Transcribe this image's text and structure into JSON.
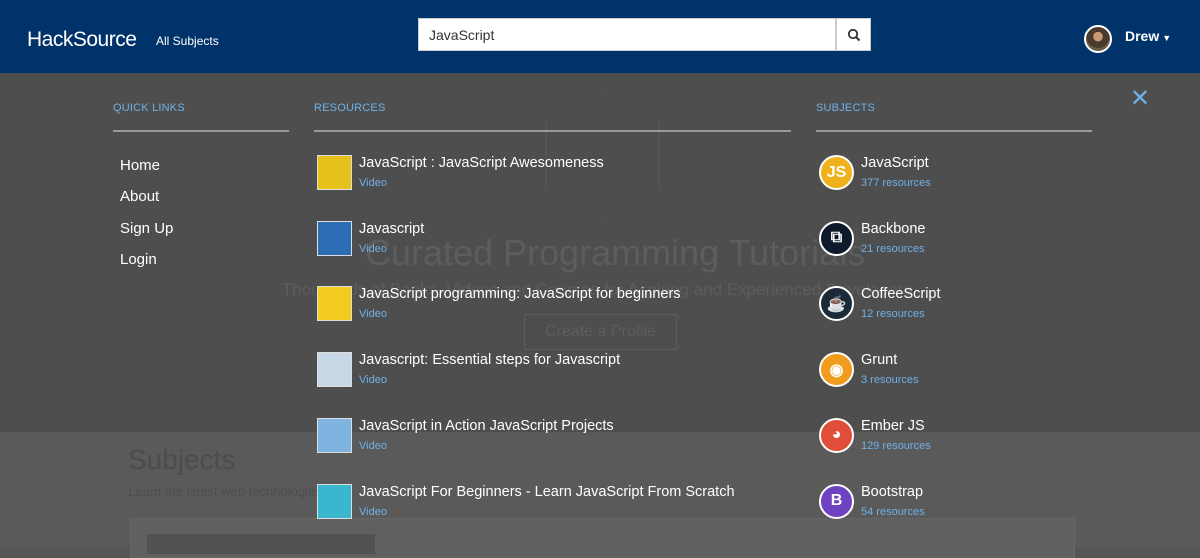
{
  "nav": {
    "logo": "HackSource",
    "all_subjects": "All Subjects",
    "search_value": "JavaScript",
    "user": "Drew"
  },
  "background": {
    "hero_title": "Curated Programming Tutorials",
    "hero_subtitle": "Thousands of Books, Videos and Courses for Aspiring and Experienced Developers",
    "cta": "Create a Profile",
    "section_title": "Subjects",
    "section_subtitle": "Learn the latest web technologies"
  },
  "overlay": {
    "quick_links_header": "QUICK LINKS",
    "resources_header": "RESOURCES",
    "subjects_header": "SUBJECTS",
    "quick_links": [
      "Home",
      "About",
      "Sign Up",
      "Login"
    ],
    "resources": [
      {
        "title": "JavaScript : JavaScript Awesomeness",
        "type": "Video",
        "color": "#e8c21c"
      },
      {
        "title": "Javascript",
        "type": "Video",
        "color": "#2d6db5"
      },
      {
        "title": "JavaScript programming: JavaScript for beginners",
        "type": "Video",
        "color": "#f2cc1e"
      },
      {
        "title": "Javascript: Essential steps for Javascript",
        "type": "Video",
        "color": "#c9d8e6"
      },
      {
        "title": "JavaScript in Action JavaScript Projects",
        "type": "Video",
        "color": "#7fb4e0"
      },
      {
        "title": "JavaScript For Beginners - Learn JavaScript From Scratch",
        "type": "Video",
        "color": "#3ab7cf"
      }
    ],
    "subjects": [
      {
        "name": "JavaScript",
        "count": "377 resources",
        "glyph": "JS",
        "color": "#f0b21a"
      },
      {
        "name": "Backbone",
        "count": "21 resources",
        "glyph": "⧉",
        "color": "#0d1a2b"
      },
      {
        "name": "CoffeeScript",
        "count": "12 resources",
        "glyph": "☕",
        "color": "#1c2a3a"
      },
      {
        "name": "Grunt",
        "count": "3 resources",
        "glyph": "◉",
        "color": "#f29c1f"
      },
      {
        "name": "Ember JS",
        "count": "129 resources",
        "glyph": "◕",
        "color": "#e04e39"
      },
      {
        "name": "Bootstrap",
        "count": "54 resources",
        "glyph": "B",
        "color": "#6f42c1"
      }
    ]
  }
}
